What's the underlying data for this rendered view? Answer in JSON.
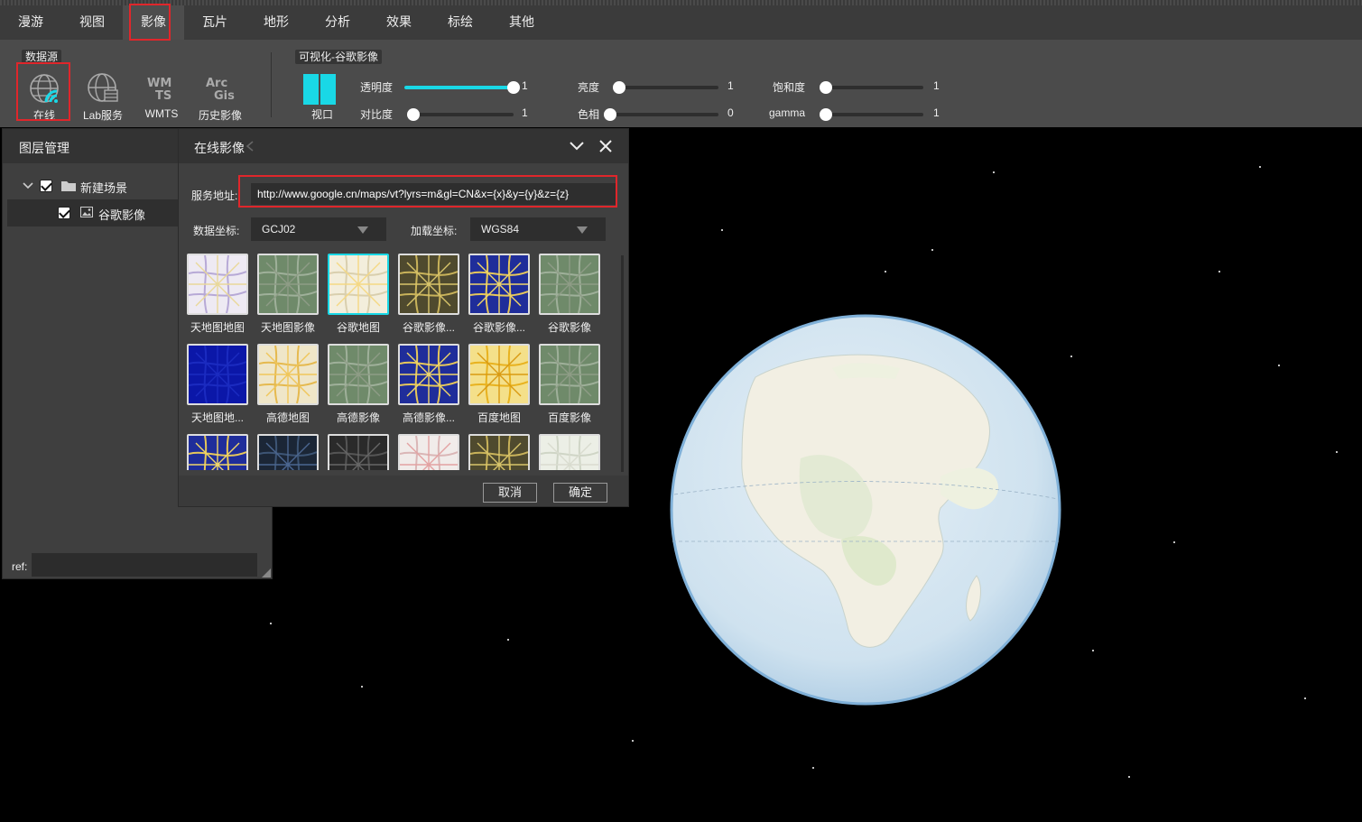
{
  "menu": {
    "items": [
      "漫游",
      "视图",
      "影像",
      "瓦片",
      "地形",
      "分析",
      "效果",
      "标绘",
      "其他"
    ],
    "active_index": 2
  },
  "toolbar": {
    "datasource_label": "数据源",
    "datasource_buttons": [
      {
        "label": "在线",
        "icon": "globe-online-icon"
      },
      {
        "label": "Lab服务",
        "icon": "globe-grid-icon"
      },
      {
        "label": "WMTS",
        "icon": "wmts-icon"
      },
      {
        "label": "历史影像",
        "icon": "arcgis-icon"
      }
    ],
    "visual_label": "可视化-谷歌影像",
    "viewport_label": "视口",
    "sliders": [
      {
        "label": "透明度",
        "value": "1",
        "fraction": 1.0
      },
      {
        "label": "对比度",
        "value": "1",
        "fraction": 0.0
      },
      {
        "label": "亮度",
        "value": "1",
        "fraction": 0.0
      },
      {
        "label": "色相",
        "value": "0",
        "fraction": 0.0
      },
      {
        "label": "饱和度",
        "value": "1",
        "fraction": 0.0
      },
      {
        "label": "gamma",
        "value": "1",
        "fraction": 0.0
      }
    ]
  },
  "layer_panel": {
    "title": "图层管理",
    "tree": [
      {
        "label": "新建场景",
        "checked": true,
        "icon": "folder-icon"
      },
      {
        "label": "谷歌影像",
        "checked": true,
        "icon": "image-icon"
      }
    ],
    "ref_label": "ref:",
    "ref_value": ""
  },
  "dialog": {
    "title": "在线影像",
    "url_label": "服务地址:",
    "url_value": "http://www.google.cn/maps/vt?lyrs=m&gl=CN&x={x}&y={y}&z={z}",
    "data_crs_label": "数据坐标:",
    "data_crs_value": "GCJ02",
    "load_crs_label": "加载坐标:",
    "load_crs_value": "WGS84",
    "tiles": [
      {
        "name": "天地图地图",
        "style": "map-light"
      },
      {
        "name": "天地图影像",
        "style": "satellite"
      },
      {
        "name": "谷歌地图",
        "style": "map-beige",
        "selected": true
      },
      {
        "name": "谷歌影像...",
        "style": "satellite-dark"
      },
      {
        "name": "谷歌影像...",
        "style": "map-blue"
      },
      {
        "name": "谷歌影像",
        "style": "satellite"
      },
      {
        "name": "天地图地...",
        "style": "map-blue-solid"
      },
      {
        "name": "高德地图",
        "style": "map-yellow"
      },
      {
        "name": "高德影像",
        "style": "satellite"
      },
      {
        "name": "高德影像...",
        "style": "map-blue"
      },
      {
        "name": "百度地图",
        "style": "map-yellow-bright"
      },
      {
        "name": "百度影像",
        "style": "satellite"
      },
      {
        "name": "",
        "style": "map-blue"
      },
      {
        "name": "",
        "style": "map-dark"
      },
      {
        "name": "",
        "style": "map-black"
      },
      {
        "name": "",
        "style": "map-light-pink"
      },
      {
        "name": "",
        "style": "satellite-dark"
      },
      {
        "name": "",
        "style": "map-pale"
      }
    ],
    "cancel_label": "取消",
    "ok_label": "确定"
  },
  "colors": {
    "accent": "#19d8e6",
    "highlight": "#e0262b"
  }
}
